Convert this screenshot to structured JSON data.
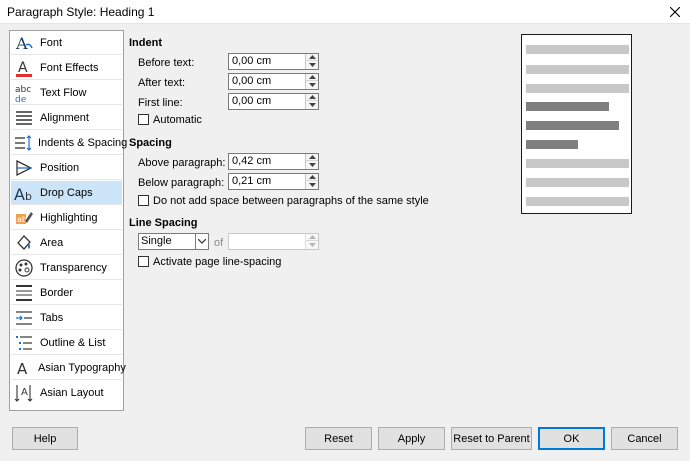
{
  "window": {
    "title": "Paragraph Style: Heading 1",
    "close_icon": "close-icon"
  },
  "sidebar": {
    "items": [
      {
        "label": "Font",
        "icon": "font-icon"
      },
      {
        "label": "Font Effects",
        "icon": "font-effects-icon"
      },
      {
        "label": "Text Flow",
        "icon": "text-flow-icon"
      },
      {
        "label": "Alignment",
        "icon": "alignment-icon"
      },
      {
        "label": "Indents & Spacing",
        "icon": "indents-spacing-icon"
      },
      {
        "label": "Position",
        "icon": "position-icon"
      },
      {
        "label": "Drop Caps",
        "icon": "drop-caps-icon"
      },
      {
        "label": "Highlighting",
        "icon": "highlighting-icon"
      },
      {
        "label": "Area",
        "icon": "area-icon"
      },
      {
        "label": "Transparency",
        "icon": "transparency-icon"
      },
      {
        "label": "Border",
        "icon": "border-icon"
      },
      {
        "label": "Tabs",
        "icon": "tabs-icon"
      },
      {
        "label": "Outline & List",
        "icon": "outline-list-icon"
      },
      {
        "label": "Asian Typography",
        "icon": "asian-typography-icon"
      },
      {
        "label": "Asian Layout",
        "icon": "asian-layout-icon"
      }
    ],
    "selected": "Indents & Spacing",
    "hovered": "Drop Caps"
  },
  "indent": {
    "heading": "Indent",
    "before_text_label": "Before text:",
    "before_text_value": "0,00 cm",
    "after_text_label": "After text:",
    "after_text_value": "0,00 cm",
    "first_line_label": "First line:",
    "first_line_value": "0,00 cm",
    "automatic_label": "Automatic"
  },
  "spacing": {
    "heading": "Spacing",
    "above_label": "Above paragraph:",
    "above_value": "0,42 cm",
    "below_label": "Below paragraph:",
    "below_value": "0,21 cm",
    "no_space_label": "Do not add space between paragraphs of the same style"
  },
  "line_spacing": {
    "heading": "Line Spacing",
    "mode_value": "Single",
    "of_label": "of",
    "of_value": "",
    "activate_label": "Activate page line-spacing"
  },
  "buttons": {
    "help": "Help",
    "reset": "Reset",
    "apply": "Apply",
    "reset_to_parent": "Reset to Parent",
    "ok": "OK",
    "cancel": "Cancel"
  },
  "colors": {
    "selection": "#cce4f7",
    "preview_light": "#c8c8c8",
    "preview_dark": "#7f7f7f",
    "default_border": "#0078d7"
  }
}
